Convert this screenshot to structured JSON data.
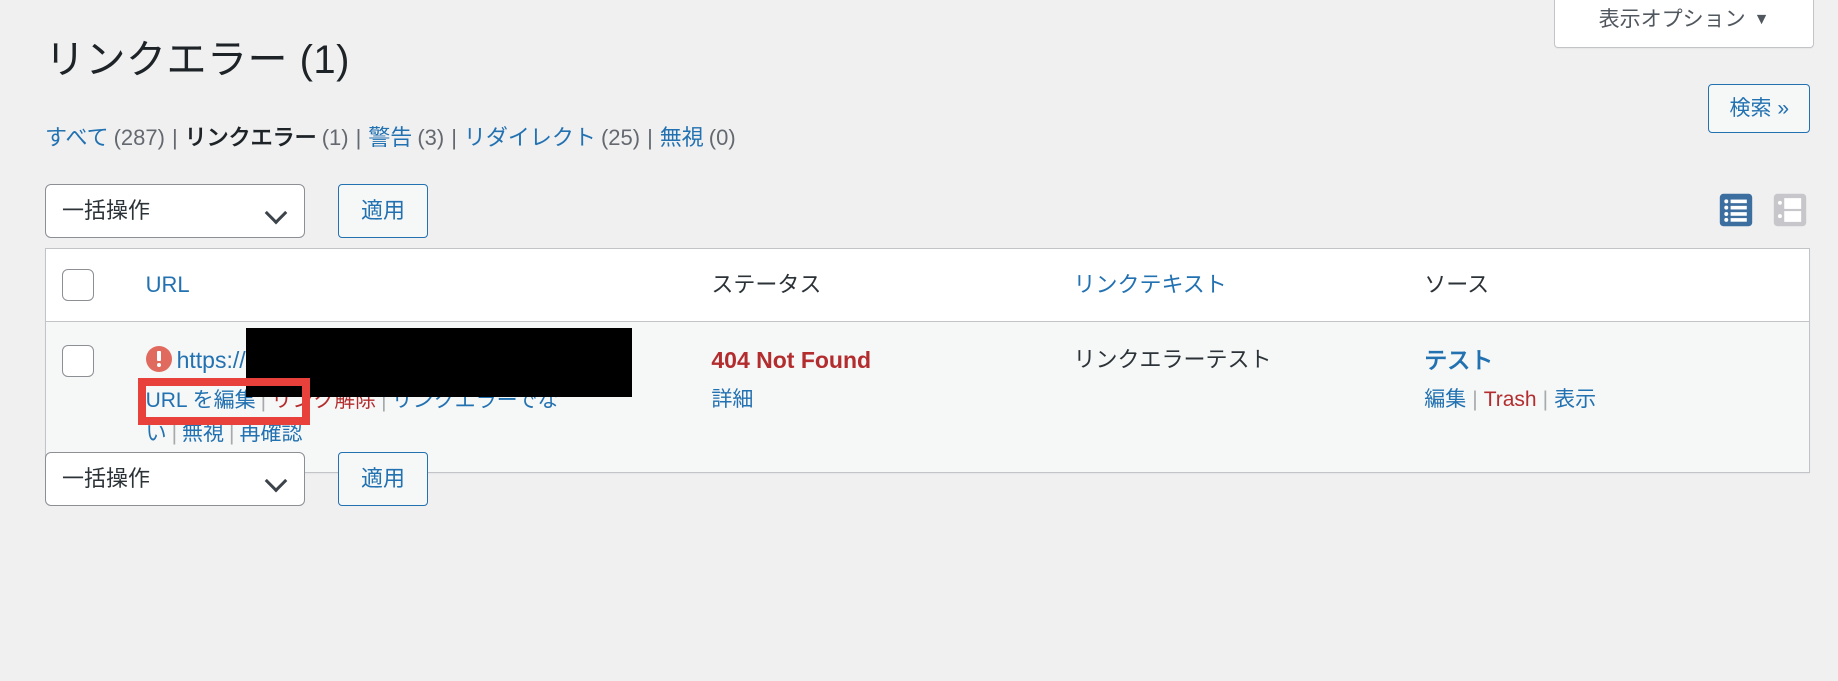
{
  "screen_options": {
    "label": "表示オプション",
    "caret": "▼"
  },
  "page": {
    "title": "リンクエラー (1)"
  },
  "search": {
    "label": "検索 »"
  },
  "filters": [
    {
      "label": "すべて",
      "count": "(287)",
      "current": false
    },
    {
      "label": "リンクエラー",
      "count": "(1)",
      "current": true
    },
    {
      "label": "警告",
      "count": "(3)",
      "current": false
    },
    {
      "label": "リダイレクト",
      "count": "(25)",
      "current": false
    },
    {
      "label": "無視",
      "count": "(0)",
      "current": false
    }
  ],
  "separator": "|",
  "tablenav": {
    "bulk_label": "一括操作",
    "apply_label": "適用",
    "view_list_name": "list-view",
    "view_excerpt_name": "excerpt-view"
  },
  "table": {
    "columns": {
      "url": "URL",
      "status": "ステータス",
      "link_text": "リンクテキスト",
      "source": "ソース"
    },
    "rows": [
      {
        "url_prefix": "https://",
        "url_redacted": true,
        "actions": [
          {
            "label": "URL を編集",
            "danger": false,
            "highlighted": true
          },
          {
            "label": "リンク解除",
            "danger": true,
            "highlighted": false
          },
          {
            "label": "リンクエラーでない",
            "danger": false,
            "highlighted": false
          },
          {
            "label": "無視",
            "danger": false,
            "highlighted": false
          },
          {
            "label": "再確認",
            "danger": false,
            "highlighted": false
          }
        ],
        "status": "404 Not Found",
        "status_detail": "詳細",
        "link_text": "リンクエラーテスト",
        "source_title": "テスト",
        "source_actions": [
          {
            "label": "編集",
            "danger": false
          },
          {
            "label": "Trash",
            "danger": true
          },
          {
            "label": "表示",
            "danger": false
          }
        ]
      }
    ]
  },
  "colors": {
    "link": "#2271b1",
    "danger": "#b32d2e",
    "error_icon": "#e16a5f",
    "highlight_border": "#e8403a",
    "page_bg": "#f0f0f1",
    "row_bg": "#f6f7f7",
    "view_active": "#3c6e9f",
    "view_inactive": "#c7c7cb"
  }
}
